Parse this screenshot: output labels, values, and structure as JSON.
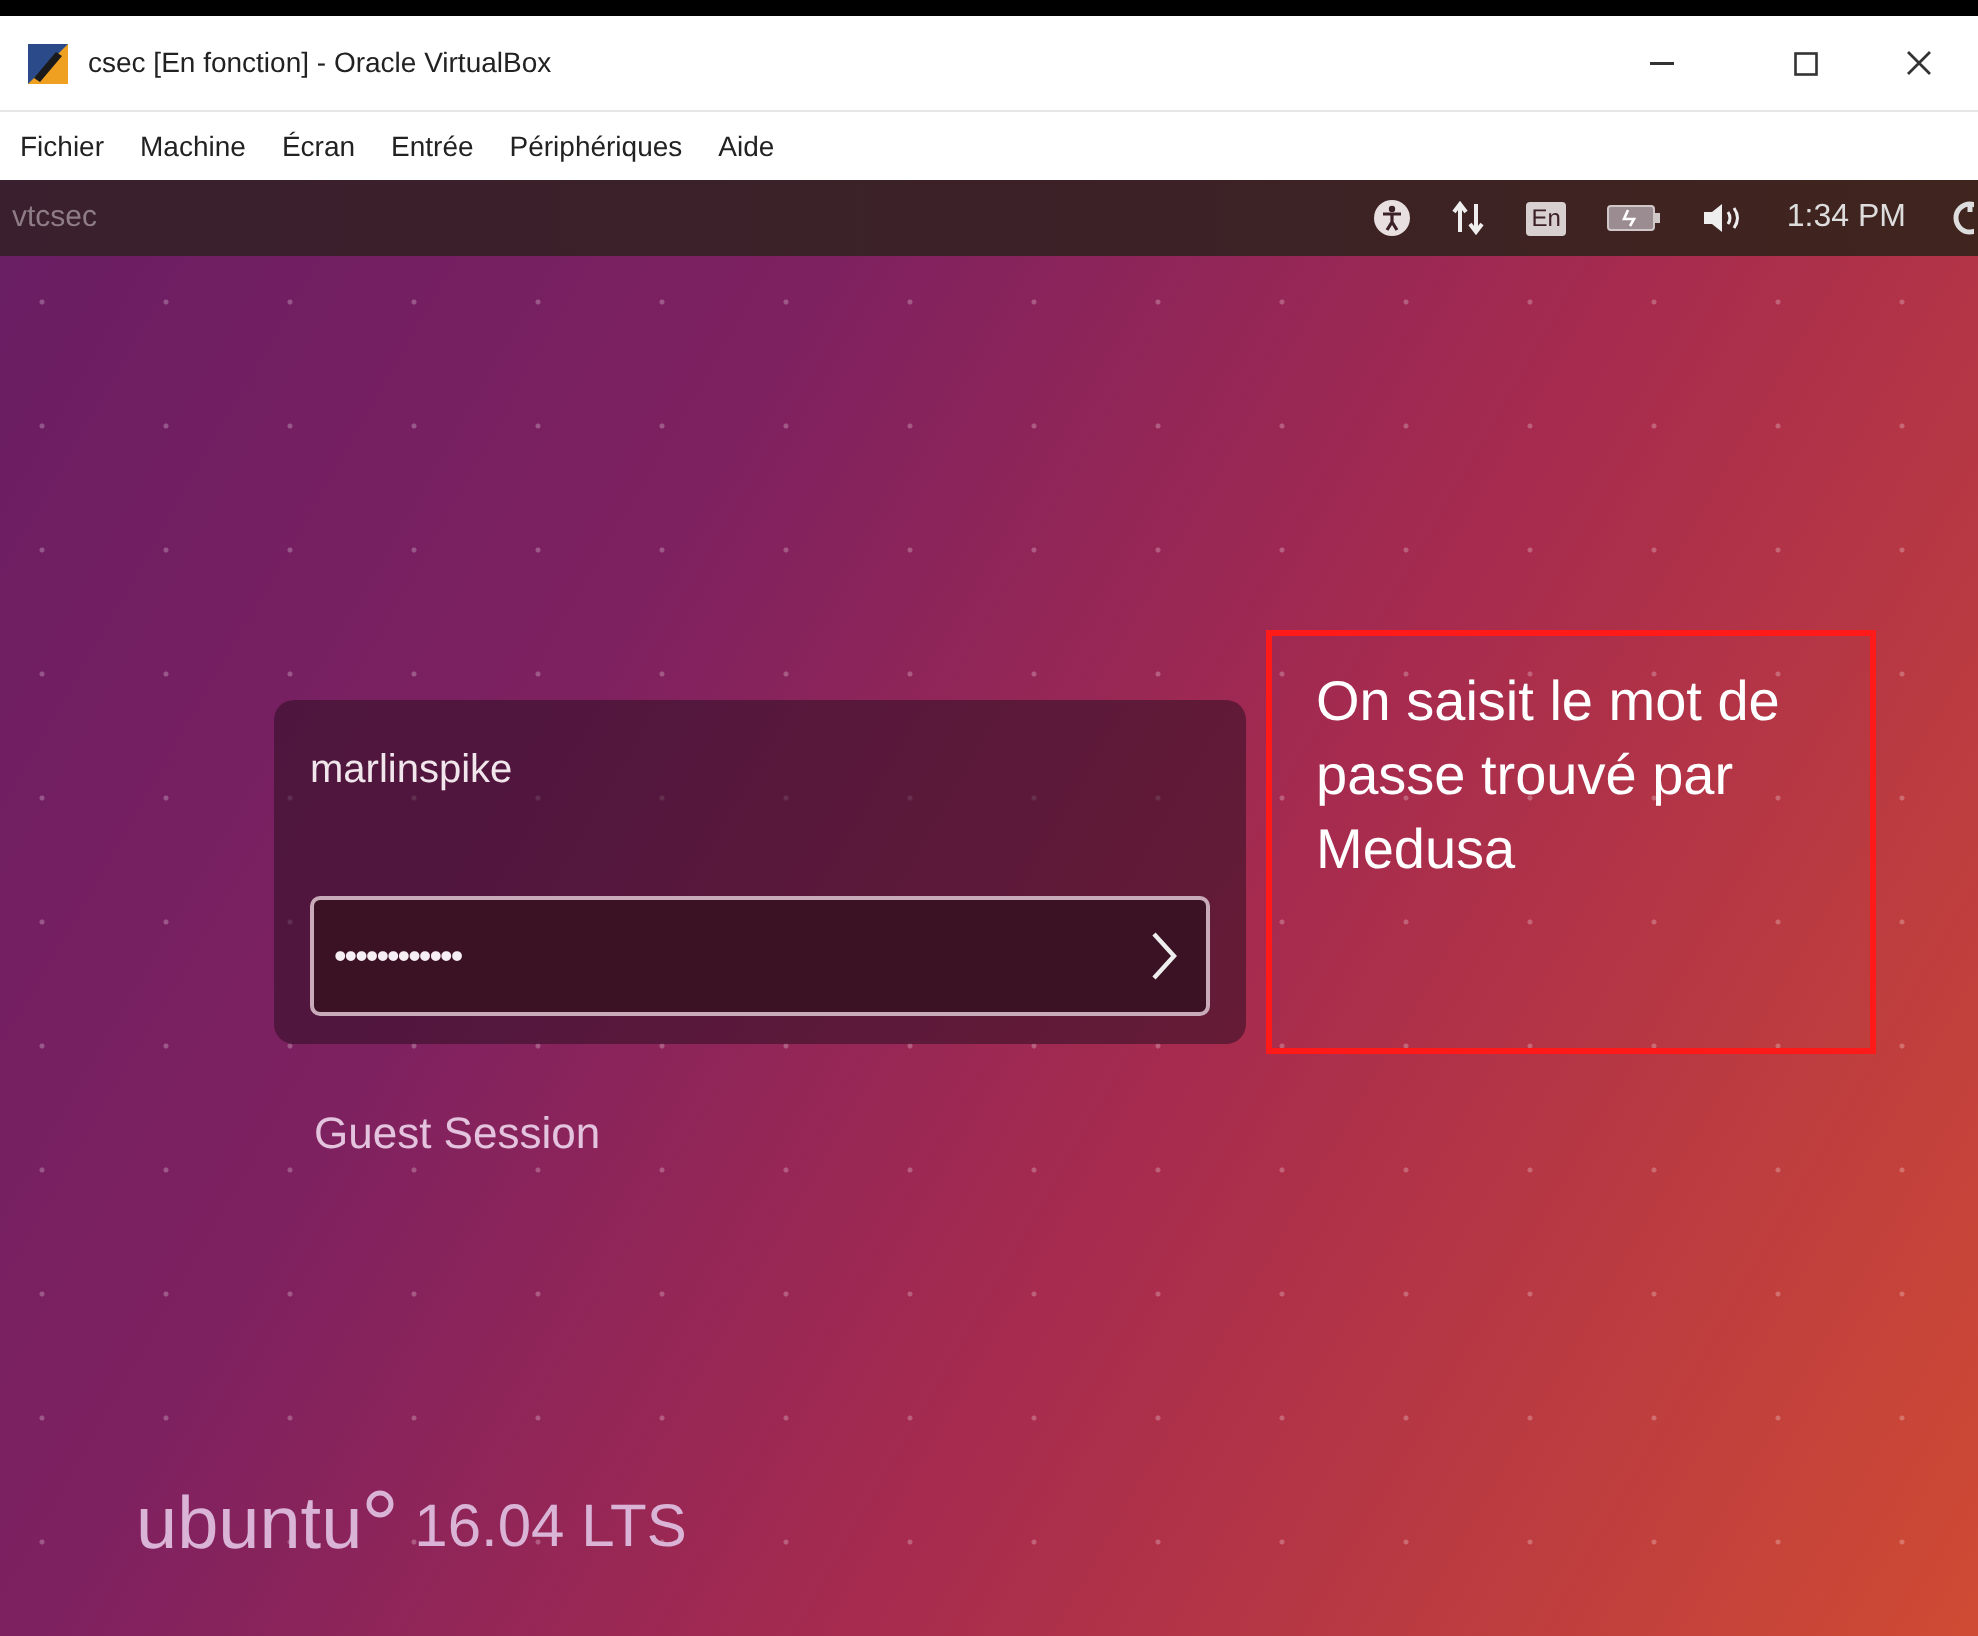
{
  "window": {
    "title": "csec [En fonction] - Oracle VirtualBox"
  },
  "menu": [
    "Fichier",
    "Machine",
    "Écran",
    "Entrée",
    "Périphériques",
    "Aide"
  ],
  "panel": {
    "hostname": "vtcsec",
    "keyboard_layout": "En",
    "time": "1:34 PM"
  },
  "login": {
    "username": "marlinspike",
    "password": "••••••••••••",
    "guest_session": "Guest Session"
  },
  "annotation": {
    "text": "On saisit le mot de passe trouvé par Medusa"
  },
  "branding": {
    "logo_text": "ubuntu",
    "version": "16.04 LTS"
  }
}
